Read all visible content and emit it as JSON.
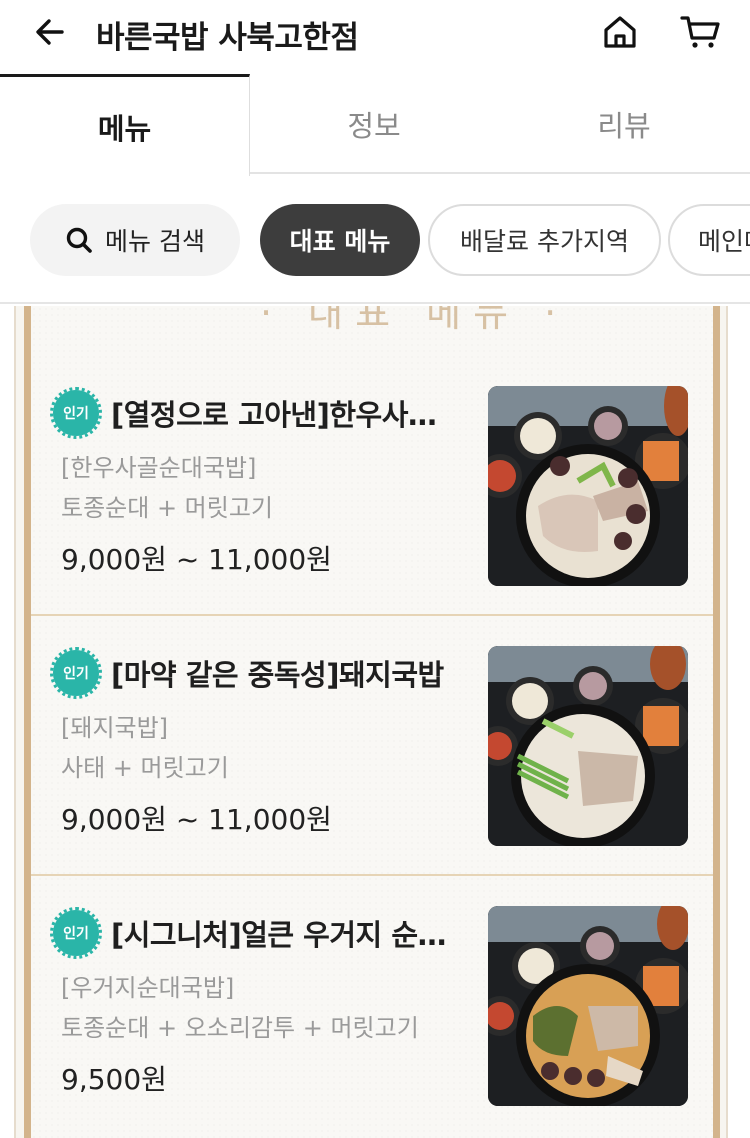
{
  "header": {
    "title": "바른국밥 사북고한점",
    "back_icon": "back-arrow-icon",
    "home_icon": "home-icon",
    "cart_icon": "cart-icon"
  },
  "tabs": [
    {
      "label": "메뉴",
      "active": true
    },
    {
      "label": "정보",
      "active": false
    },
    {
      "label": "리뷰",
      "active": false
    }
  ],
  "chips": {
    "search": {
      "label": "메뉴 검색",
      "icon": "search-icon"
    },
    "items": [
      {
        "label": "대표 메뉴",
        "selected": true
      },
      {
        "label": "배달료 추가지역",
        "selected": false
      },
      {
        "label": "메인메",
        "selected": false
      }
    ]
  },
  "menu": [
    {
      "badge": "인기",
      "name": "[열정으로 고아낸]한우사…",
      "sub": "[한우사골순대국밥]",
      "desc": "토종순대 + 머릿고기",
      "price": "9,000원 ~ 11,000원",
      "image": "gukbap-photo"
    },
    {
      "badge": "인기",
      "name": "[마약 같은 중독성]돼지국밥",
      "sub": "[돼지국밥]",
      "desc": "사태 + 머릿고기",
      "price": "9,000원 ~ 11,000원",
      "image": "gukbap-photo"
    },
    {
      "badge": "인기",
      "name": "[시그니처]얼큰 우거지 순…",
      "sub": "[우거지순대국밥]",
      "desc": "토종순대 + 오소리감투 + 머릿고기",
      "price": "9,500원",
      "image": "gukbap-photo"
    }
  ],
  "colors": {
    "accent_badge": "#2ab5a8",
    "frame": "#d3b48c",
    "chip_selected": "#3d3d3d"
  }
}
